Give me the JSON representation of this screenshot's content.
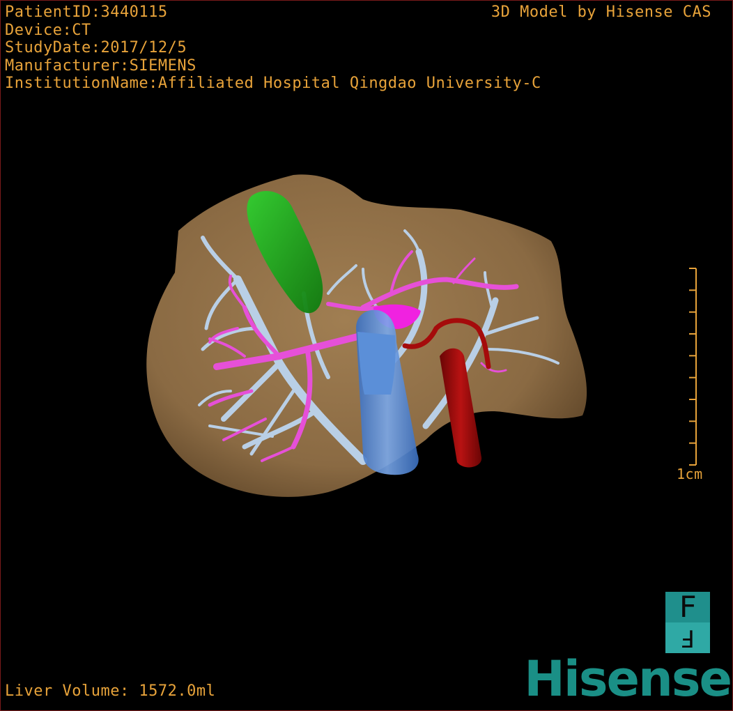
{
  "patient": {
    "id_line": "PatientID:3440115",
    "device_line": "Device:CT",
    "study_date_line": "StudyDate:2017/12/5",
    "manufacturer_line": "Manufacturer:SIEMENS",
    "institution_line": "InstitutionName:Affiliated Hospital Qingdao University-C"
  },
  "credit": "3D Model by Hisense CAS",
  "measurement": {
    "liver_volume_line": "Liver Volume: 1572.0ml"
  },
  "scale": {
    "label": "1cm",
    "tick_count": 10
  },
  "orientation_cube": {
    "upper_glyph": "F",
    "lower_glyph": "F",
    "color": "#1f8f8c"
  },
  "brand": {
    "logo_text": "Hisense",
    "color": "#1a8f86"
  },
  "colors": {
    "text": "#e8a33a",
    "liver": "#8f6d45",
    "gallbladder": "#1fa01f",
    "hepatic_veins": "#b9cfe6",
    "portal_vein": "#e650d8",
    "ivc": "#5b8fd8",
    "artery": "#a50b0b"
  }
}
